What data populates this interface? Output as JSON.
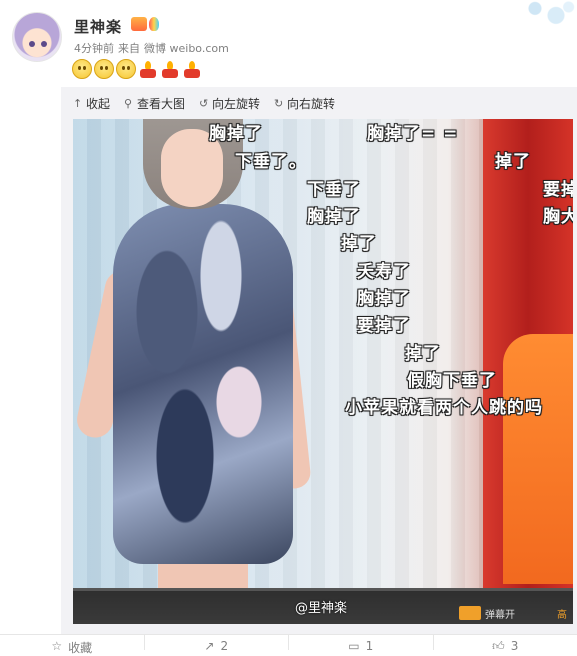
{
  "post": {
    "username": "里神楽",
    "time": "4分钟前",
    "source_prefix": "来自",
    "source": "微博 weibo.com",
    "emojis": [
      "smile-face-icon",
      "smile-face-icon",
      "smile-face-icon",
      "candle-icon",
      "candle-icon",
      "candle-icon"
    ]
  },
  "toolbar": {
    "collapse": "收起",
    "view_large": "查看大图",
    "rotate_left": "向左旋转",
    "rotate_right": "向右旋转"
  },
  "image": {
    "danmaku": [
      "胸掉了",
      "胸掉了= =",
      "下垂了。",
      "掉了",
      "下垂了",
      "要掉",
      "胸掉了",
      "胸大",
      "掉了",
      "夭寿了",
      "胸掉了",
      "要掉了",
      "掉了",
      "假胸下垂了",
      "小苹果就看两个人跳的吗"
    ],
    "watermark": "@里神楽",
    "bar_labels": [
      "弹幕开",
      "高"
    ]
  },
  "actions": [
    {
      "icon": "star-icon",
      "label": "收藏"
    },
    {
      "icon": "share-icon",
      "label": "2"
    },
    {
      "icon": "comment-icon",
      "label": "1"
    },
    {
      "icon": "like-icon",
      "label": "3"
    }
  ],
  "colors": {
    "accent_red": "#cf2e2a",
    "text_gray": "#808080"
  }
}
